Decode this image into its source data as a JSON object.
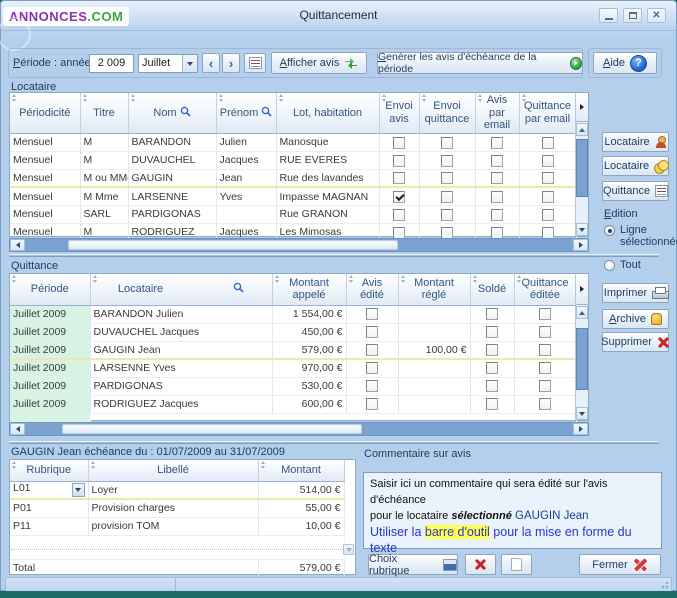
{
  "colors": {
    "selected_row_border": "#c08448",
    "mint_column": "#d7f3e4",
    "comment_link_blue": "#2a35c8",
    "highlight_yellow": "#ffff55",
    "bottom_strip_teal": "#1d6b66"
  },
  "window": {
    "title": "Quittancement",
    "logo_part1": "ANNONCES",
    "logo_part2": ".COM"
  },
  "icons": {
    "minimize": "–",
    "close": "✕",
    "prev": "‹",
    "next": "›",
    "aide_qmark": "?"
  },
  "toolbar": {
    "period_accel": "P",
    "period_rest": "ériode : année",
    "year": "2 009",
    "month": "Juillet",
    "afficher_accel": "A",
    "afficher_rest": "fficher avis",
    "generer_accel": "G",
    "generer_rest": "enérer les avis d'échéance de la période",
    "aide_accel": "A",
    "aide_rest": "ide"
  },
  "locataire": {
    "label": "Locataire",
    "columns": [
      "Périodicité",
      "Titre",
      "Nom",
      "Prénom",
      "Lot, habitation",
      "Envoi avis",
      "Envoi quittance",
      "Avis par email",
      "Quittance par email"
    ],
    "rows": [
      {
        "periodicite": "Mensuel",
        "titre": "M",
        "nom": "BARANDON",
        "prenom": "Julien",
        "lot": "Manosque",
        "envoi_avis": false,
        "envoi_quittance": false,
        "avis_email": false,
        "quittance_email": false,
        "selected": false
      },
      {
        "periodicite": "Mensuel",
        "titre": "M",
        "nom": "DUVAUCHEL",
        "prenom": "Jacques",
        "lot": "RUE EVERES",
        "envoi_avis": false,
        "envoi_quittance": false,
        "avis_email": false,
        "quittance_email": false,
        "selected": false
      },
      {
        "periodicite": "Mensuel",
        "titre": "M ou MMe",
        "nom": "GAUGIN",
        "prenom": "Jean",
        "lot": "Rue des lavandes",
        "envoi_avis": false,
        "envoi_quittance": false,
        "avis_email": false,
        "quittance_email": false,
        "selected": true
      },
      {
        "periodicite": "Mensuel",
        "titre": "M Mme",
        "nom": "LARSENNE",
        "prenom": "Yves",
        "lot": "Impasse MAGNAN",
        "envoi_avis": true,
        "envoi_quittance": false,
        "avis_email": false,
        "quittance_email": false,
        "selected": false
      },
      {
        "periodicite": "Mensuel",
        "titre": "SARL",
        "nom": "PARDIGONAS",
        "prenom": "",
        "lot": "Rue GRANON",
        "envoi_avis": false,
        "envoi_quittance": false,
        "avis_email": false,
        "quittance_email": false,
        "selected": false
      },
      {
        "periodicite": "Mensuel",
        "titre": "M",
        "nom": "RODRIGUEZ",
        "prenom": "Jacques",
        "lot": "Les Mimosas",
        "envoi_avis": false,
        "envoi_quittance": false,
        "avis_email": false,
        "quittance_email": false,
        "selected": false
      }
    ]
  },
  "side_panel": {
    "locataire_btn1": "Locataire",
    "locataire_btn2": "Locataire",
    "quittance_btn": "Quittance",
    "edition_accel": "E",
    "edition_rest": "dition",
    "radio_ligne": "Ligne sélectionnée",
    "radio_tout": "Tout",
    "ligne_selected": true,
    "tout_selected": false,
    "imprimer": "Imprimer",
    "archive_accel": "A",
    "archive_rest": "rchive",
    "supprimer": "Supprimer"
  },
  "quittance": {
    "label": "Quittance",
    "columns": [
      "Période",
      "Locataire",
      "Montant appelé",
      "Avis édité",
      "Montant réglé",
      "Soldé",
      "Quittance éditée"
    ],
    "rows": [
      {
        "periode": "Juillet 2009",
        "locataire": "BARANDON Julien",
        "appele": "1 554,00 €",
        "avis_edite": false,
        "regle": "",
        "solde": false,
        "editee": false,
        "selected": false
      },
      {
        "periode": "Juillet 2009",
        "locataire": "DUVAUCHEL Jacques",
        "appele": "450,00 €",
        "avis_edite": false,
        "regle": "",
        "solde": false,
        "editee": false,
        "selected": false
      },
      {
        "periode": "Juillet 2009",
        "locataire": "GAUGIN Jean",
        "appele": "579,00 €",
        "avis_edite": false,
        "regle": "100,00 €",
        "solde": false,
        "editee": false,
        "selected": true
      },
      {
        "periode": "Juillet 2009",
        "locataire": "LARSENNE Yves",
        "appele": "970,00 €",
        "avis_edite": false,
        "regle": "",
        "solde": false,
        "editee": false,
        "selected": false
      },
      {
        "periode": "Juillet 2009",
        "locataire": "PARDIGONAS",
        "appele": "530,00 €",
        "avis_edite": false,
        "regle": "",
        "solde": false,
        "editee": false,
        "selected": false
      },
      {
        "periode": "Juillet 2009",
        "locataire": "RODRIGUEZ Jacques",
        "appele": "600,00 €",
        "avis_edite": false,
        "regle": "",
        "solde": false,
        "editee": false,
        "selected": false
      }
    ]
  },
  "echeance": {
    "title": "GAUGIN Jean échéance du : 01/07/2009  au  31/07/2009",
    "columns": [
      "Rubrique",
      "Libellé",
      "Montant"
    ],
    "rows": [
      {
        "rubrique": "L01",
        "libelle": "Loyer",
        "montant": "514,00 €",
        "selected": true
      },
      {
        "rubrique": "P01",
        "libelle": "Provision charges",
        "montant": "55,00 €",
        "selected": false
      },
      {
        "rubrique": "P11",
        "libelle": "provision TOM",
        "montant": "10,00 €",
        "selected": false
      }
    ],
    "total_label": "Total",
    "total_value": "579,00 €"
  },
  "comment": {
    "label": "Commentaire sur avis",
    "line1": "Saisir ici un commentaire qui sera édité sur l'avis d'échéance",
    "line2_pre": "pour le locataire ",
    "line2_em": "sélectionné",
    "line2_name": " GAUGIN Jean",
    "line3_pre": "Utiliser la ",
    "line3_hl": "barre d'outil",
    "line3_post": " pour la mise en forme du texte"
  },
  "footer": {
    "choix_rubrique": "Choix rubrique",
    "fermer": "Fermer"
  }
}
